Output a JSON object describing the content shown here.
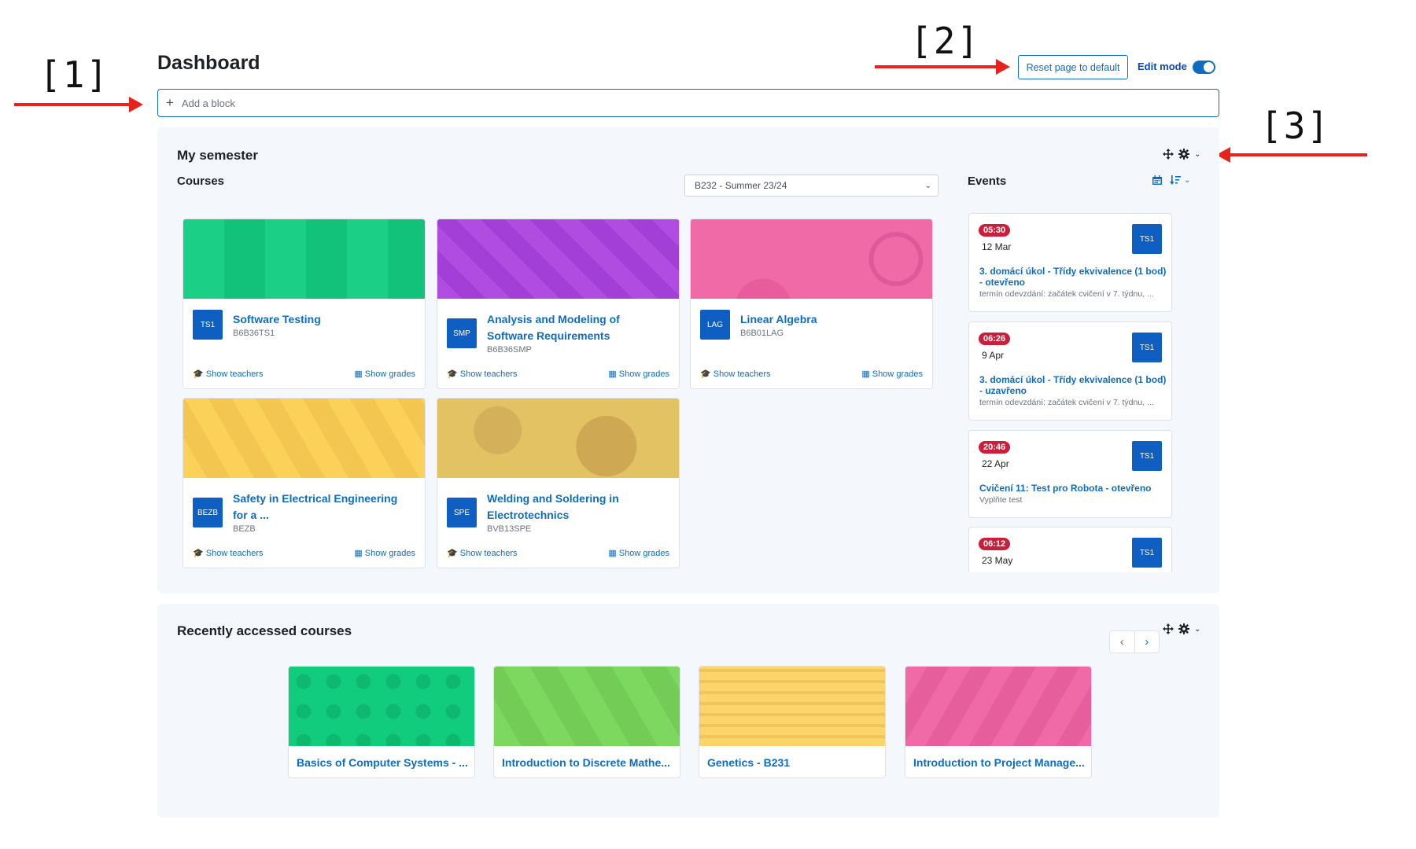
{
  "annotations": [
    "[1]",
    "[2]",
    "[3]"
  ],
  "header": {
    "title": "Dashboard",
    "reset_label": "Reset page to default",
    "edit_mode_label": "Edit mode",
    "edit_mode_on": true
  },
  "add_block": {
    "label": "Add a block",
    "plus": "+"
  },
  "my_semester": {
    "title": "My semester",
    "courses_title": "Courses",
    "semester_select": "B232 - Summer 23/24",
    "courses": [
      {
        "abbr": "TS1",
        "name": "Software Testing",
        "code": "B6B36TS1",
        "teachers_label": "Show teachers",
        "grades_label": "Show grades",
        "color": "#1ccf86"
      },
      {
        "abbr": "SMP",
        "name": "Analysis and Modeling of Software Requirements",
        "code": "B6B36SMP",
        "teachers_label": "Show teachers",
        "grades_label": "Show grades",
        "color": "#b14ce0"
      },
      {
        "abbr": "LAG",
        "name": "Linear Algebra",
        "code": "B6B01LAG",
        "teachers_label": "Show teachers",
        "grades_label": "Show grades",
        "color": "#f06aa8"
      },
      {
        "abbr": "BEZB",
        "name": "Safety in Electrical Engineering for a ...",
        "code": "BEZB",
        "teachers_label": "Show teachers",
        "grades_label": "Show grades",
        "color": "#fbd15a"
      },
      {
        "abbr": "SPE",
        "name": "Welding and Soldering in Electrotechnics",
        "code": "BVB13SPE",
        "teachers_label": "Show teachers",
        "grades_label": "Show grades",
        "color": "#e3c264"
      }
    ],
    "events_title": "Events",
    "events": [
      {
        "time": "05:30",
        "date": "12 Mar",
        "badge": "TS1",
        "name": "3. domácí úkol - Třídy ekvivalence (1 bod) - otevřeno",
        "desc": "termín odevzdání: začátek cvičení v 7. týdnu, ..."
      },
      {
        "time": "06:26",
        "date": "9 Apr",
        "badge": "TS1",
        "name": "3. domácí úkol - Třídy ekvivalence (1 bod) - uzavřeno",
        "desc": "termín odevzdání: začátek cvičení v 7. týdnu, ..."
      },
      {
        "time": "20:46",
        "date": "22 Apr",
        "badge": "TS1",
        "name": "Cvičení 11: Test pro Robota - otevřeno",
        "desc": "Vyplňte test"
      },
      {
        "time": "06:12",
        "date": "23 May",
        "badge": "TS1",
        "name": "",
        "desc": ""
      }
    ]
  },
  "recent": {
    "title": "Recently accessed courses",
    "prev": "‹",
    "next": "›",
    "courses": [
      {
        "name": "Basics of Computer Systems - ...",
        "color": "#12cc7e"
      },
      {
        "name": "Introduction to Discrete Mathe...",
        "color": "#7dd860"
      },
      {
        "name": "Genetics - B231",
        "color": "#fbd46a"
      },
      {
        "name": "Introduction to Project Manage...",
        "color": "#f16aa8"
      }
    ]
  },
  "colors": {
    "accent": "#0f6cbf",
    "annotation_arrow": "#e8231d",
    "event_time": "#ca1e3a"
  },
  "icons": [
    "plus-icon",
    "move-icon",
    "gear-icon",
    "chevron-down-icon",
    "calendar-icon",
    "sort-icon",
    "graduation-cap-icon",
    "table-icon",
    "chevron-left-icon",
    "chevron-right-icon"
  ]
}
